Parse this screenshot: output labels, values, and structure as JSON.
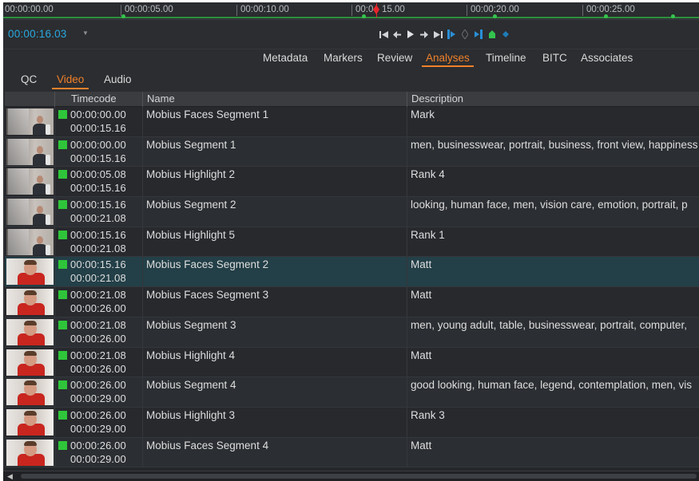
{
  "ruler": {
    "ticks": [
      "00:00:00.00",
      "00:00:05.00",
      "00:00:10.00",
      "00:0",
      "15.00",
      "00:00:20.00",
      "00:00:25.00"
    ]
  },
  "transport": {
    "timecode": "00:00:16.03",
    "dropdown": "▼"
  },
  "tabs": [
    "Metadata",
    "Markers",
    "Review",
    "Analyses",
    "Timeline",
    "BITC",
    "Associates"
  ],
  "active_tab": "Analyses",
  "subtabs": [
    "QC",
    "Video",
    "Audio"
  ],
  "active_subtab": "Video",
  "table": {
    "columns": [
      "Timecode",
      "Name",
      "Description"
    ],
    "rows": [
      {
        "in": "00:00:00.00",
        "out": "00:00:15.16",
        "name": "Mobius Faces Segment 1",
        "desc": "Mark",
        "thumb": "mark"
      },
      {
        "in": "00:00:00.00",
        "out": "00:00:15.16",
        "name": "Mobius Segment 1",
        "desc": "men, businesswear, portrait, business, front view, happiness",
        "thumb": "mark"
      },
      {
        "in": "00:00:05.08",
        "out": "00:00:15.16",
        "name": "Mobius Highlight 2",
        "desc": "Rank 4",
        "thumb": "mark"
      },
      {
        "in": "00:00:15.16",
        "out": "00:00:21.08",
        "name": "Mobius Segment 2",
        "desc": "looking, human face, men, vision care, emotion, portrait, p",
        "thumb": "mark"
      },
      {
        "in": "00:00:15.16",
        "out": "00:00:21.08",
        "name": "Mobius Highlight 5",
        "desc": "Rank 1",
        "thumb": "mark"
      },
      {
        "in": "00:00:15.16",
        "out": "00:00:21.08",
        "name": "Mobius Faces Segment 2",
        "desc": "Matt",
        "thumb": "matt",
        "selected": true
      },
      {
        "in": "00:00:21.08",
        "out": "00:00:26.00",
        "name": "Mobius Faces Segment 3",
        "desc": "Matt",
        "thumb": "matt"
      },
      {
        "in": "00:00:21.08",
        "out": "00:00:26.00",
        "name": "Mobius Segment 3",
        "desc": "men, young adult, table, businesswear, portrait, computer, ",
        "thumb": "matt"
      },
      {
        "in": "00:00:21.08",
        "out": "00:00:26.00",
        "name": "Mobius Highlight 4",
        "desc": "Matt",
        "thumb": "matt"
      },
      {
        "in": "00:00:26.00",
        "out": "00:00:29.00",
        "name": "Mobius Segment 4",
        "desc": "good looking, human face, legend, contemplation, men, vis",
        "thumb": "matt"
      },
      {
        "in": "00:00:26.00",
        "out": "00:00:29.00",
        "name": "Mobius Highlight 3",
        "desc": "Rank 3",
        "thumb": "matt"
      },
      {
        "in": "00:00:26.00",
        "out": "00:00:29.00",
        "name": "Mobius Faces Segment 4",
        "desc": "Matt",
        "thumb": "matt"
      }
    ]
  },
  "colors": {
    "accent": "#f0812b",
    "timecode": "#29a8e0",
    "status": "#2fc53a",
    "playhead": "#e8262b",
    "selected_row": "#233f47"
  }
}
